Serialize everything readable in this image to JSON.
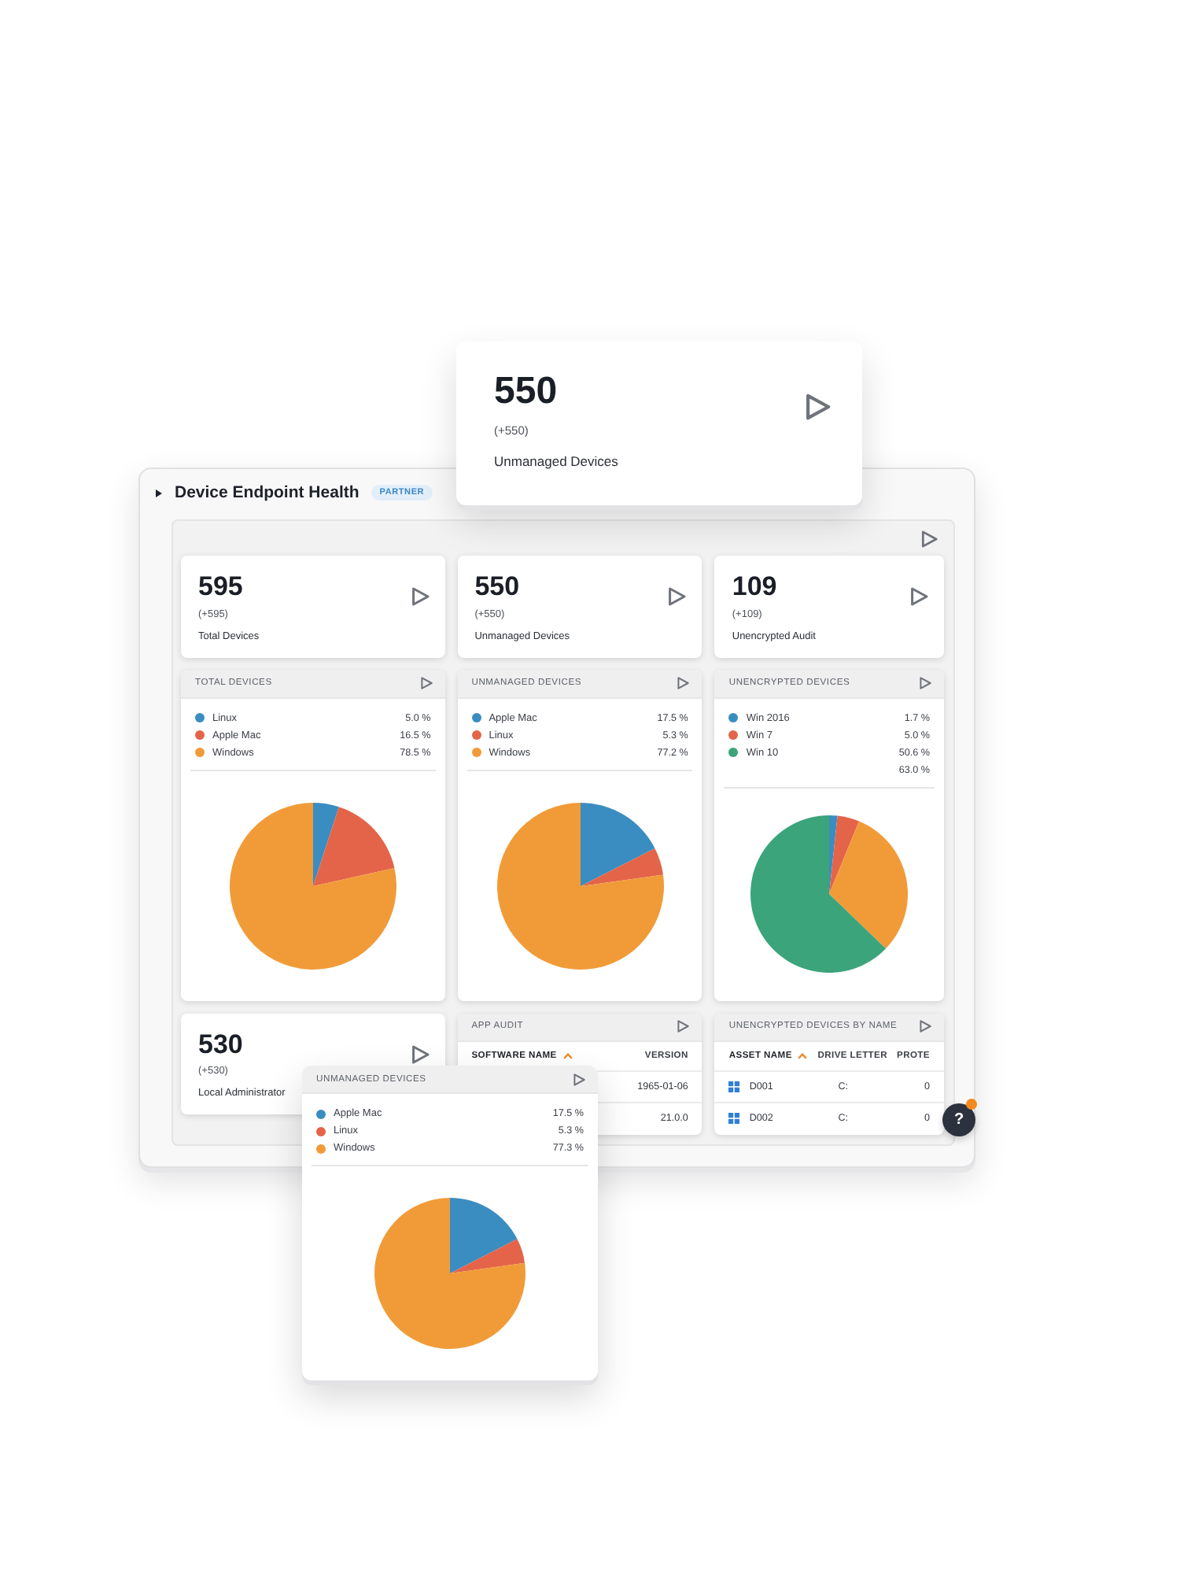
{
  "floating_stat_card": {
    "value": "550",
    "delta": "(+550)",
    "label": "Unmanaged Devices"
  },
  "header": {
    "title": "Device Endpoint Health",
    "badge": "PARTNER"
  },
  "stat_cards": [
    {
      "value": "595",
      "delta": "(+595)",
      "label": "Total Devices"
    },
    {
      "value": "550",
      "delta": "(+550)",
      "label": "Unmanaged Devices"
    },
    {
      "value": "109",
      "delta": "(+109)",
      "label": "Unencrypted Audit"
    }
  ],
  "chart_cards": [
    {
      "title": "TOTAL DEVICES",
      "legend": [
        {
          "value": "5.0 %",
          "color": "#3a8dc0"
        },
        {
          "value": "16.5 %",
          "color": "#e4644a"
        },
        {
          "value": "78.5 %",
          "color": "#f19b38"
        }
      ],
      "chart_data": {
        "type": "pie",
        "categories": [
          "Linux",
          "Apple Mac",
          "Windows"
        ],
        "values": [
          5.0,
          16.5,
          78.5
        ]
      }
    },
    {
      "title": "UNMANAGED DEVICES",
      "legend": [
        {
          "value": "17.5 %",
          "color": "#3a8dc0"
        },
        {
          "value": "5.3 %",
          "color": "#e4644a"
        },
        {
          "value": "77.2 %",
          "color": "#f19b38"
        }
      ],
      "chart_data": {
        "type": "pie",
        "categories": [
          "Apple Mac",
          "Linux",
          "Windows"
        ],
        "values": [
          17.5,
          5.3,
          77.2
        ]
      }
    },
    {
      "title": "UNENCRYPTED DEVICES",
      "legend": [
        {
          "label": "Win 2016",
          "value": "1.7 %",
          "color": "#3a8dc0"
        },
        {
          "label": "Win 7",
          "value": "5.0 %",
          "color": "#e4644a"
        },
        {
          "label": "Win 10",
          "value": "50.6 %",
          "color": "#3ba47b"
        },
        {
          "value": "63.0 %"
        }
      ]
    }
  ],
  "admin_card": {
    "value": "530",
    "delta": "(+530)",
    "label": "Local Administrator"
  },
  "app_audit": {
    "title": "APP AUDIT",
    "columns": [
      {
        "label": "SOFTWARE NAME",
        "sorted": true
      },
      {
        "label": "VERSION",
        "sorted": false
      }
    ],
    "rows": [
      {
        "version": "1965-01-06"
      },
      {
        "version": "21.0.0"
      }
    ]
  },
  "devices_by_name": {
    "title": "UNENCRYPTED DEVICES BY NAME",
    "columns": [
      {
        "label": "ASSET NAME",
        "sorted": true
      },
      {
        "label": "DRIVE LETTER",
        "sorted": false
      },
      {
        "label": "PROTE",
        "sorted": false
      }
    ],
    "rows": [
      {
        "asset": "D001",
        "drive": "C:",
        "column_3": "0"
      },
      {
        "asset": "D002",
        "drive": "C:",
        "column_3": "0"
      }
    ]
  },
  "floating_chart_card": {
    "title": "UNMANAGED DEVICES",
    "legend": [
      {
        "value": "17.5 %",
        "color": "#3a8dc0"
      },
      {
        "value": "5.3 %",
        "color": "#e4644a"
      },
      {
        "value": "77.3 %",
        "color": "#f19b38"
      }
    ],
    "chart_data": {
      "type": "pie",
      "categories": [
        "Apple Mac",
        "Linux",
        "Windows"
      ],
      "values": [
        17.5,
        5.3,
        77.3
      ]
    }
  },
  "help_button": {
    "label": "?",
    "notification": true
  }
}
